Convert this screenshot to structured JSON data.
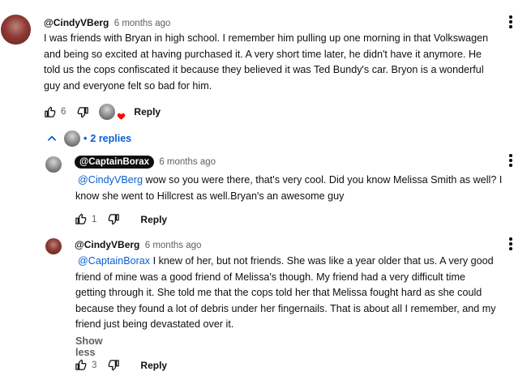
{
  "comments": [
    {
      "author": "@CindyVBerg",
      "time": "6 months ago",
      "lines": [
        "I was friends with Bryan in high school.  I remember him pulling up one morning in that Volkswagen",
        "and being so excited at having purchased it.  A very short time later, he didn't have it anymore.  He",
        "told us the cops confiscated it because they believed it was Ted Bundy's car.  Bryon is a wonderful",
        "guy and everyone felt so bad for him."
      ],
      "likes": "6",
      "reply_label": "Reply"
    }
  ],
  "replies_toggle": {
    "label": "2 replies"
  },
  "replies": [
    {
      "author": "@CaptainBorax",
      "time": "6 months ago",
      "mention": "@CindyVBerg",
      "lines": [
        " wow so you were there, that's very cool. Did you know Melissa Smith as well? I",
        "know she went to Hillcrest as well.Bryan's an awesome guy"
      ],
      "likes": "1",
      "reply_label": "Reply"
    },
    {
      "author": "@CindyVBerg",
      "time": "6 months ago",
      "mention": "@CaptainBorax",
      "lines": [
        " I knew of her, but not friends.  She was like a year older that us.  A very good",
        "friend of mine was a good friend of Melissa's though.  My friend had a very difficult time",
        "getting through it.  She told me that the cops told her that Melissa fought hard as she could",
        "because they found a lot of debris under her fingernails.  That is about all I remember, and my",
        "friend just being devastated over it."
      ],
      "show_less": "Show less",
      "likes": "3",
      "reply_label": "Reply"
    }
  ],
  "icons": {
    "like": "thumb-up-icon",
    "dislike": "thumb-down-icon",
    "menu": "more-vert-icon",
    "collapse": "chevron-up-icon",
    "heart": "heart-icon"
  },
  "colors": {
    "link": "#065fd4",
    "muted": "#606060",
    "text": "#0f0f0f",
    "heart": "#ff0000"
  }
}
